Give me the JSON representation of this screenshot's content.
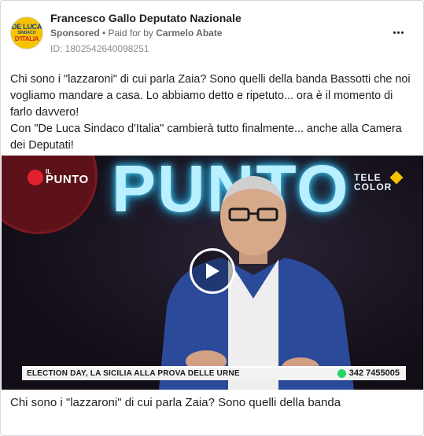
{
  "header": {
    "page_name": "Francesco Gallo Deputato Nazionale",
    "sponsored": "Sponsored",
    "separator": " • ",
    "paid_for_prefix": "Paid for by ",
    "payer": "Carmelo Abate",
    "ad_id": "ID: 1802542640098251"
  },
  "avatar": {
    "line1": "DE LUCA",
    "line2": "SINDACO",
    "line3": "D'ITALIA"
  },
  "post": {
    "paragraph1": "Chi sono i \"lazzaroni\" di cui parla Zaia? Sono quelli della banda Bassotti che noi vogliamo mandare a casa. Lo abbiamo detto e ripetuto... ora è il momento di farlo davvero!",
    "paragraph2": "Con \"De Luca Sindaco d'Italia\" cambierà tutto finalmente... anche alla Camera dei Deputati!"
  },
  "video": {
    "logo_il": "IL",
    "logo_punto": "PUNTO",
    "big_title": "PUNTO",
    "channel_line1": "TELE",
    "channel_line2": "COLOR",
    "ticker_text": "ELECTION DAY, LA SICILIA ALLA PROVA DELLE URNE",
    "ticker_phone": "342 7455005"
  },
  "caption": "Chi sono i \"lazzaroni\" di cui parla Zaia? Sono quelli della banda",
  "colors": {
    "brand_yellow": "#f4c400",
    "brand_blue": "#1a3f8f",
    "brand_red": "#d3262b",
    "neon_cyan": "#b8f0ff"
  },
  "icons": {
    "more": "more-horizontal-icon",
    "play": "play-icon",
    "whatsapp": "whatsapp-icon"
  }
}
